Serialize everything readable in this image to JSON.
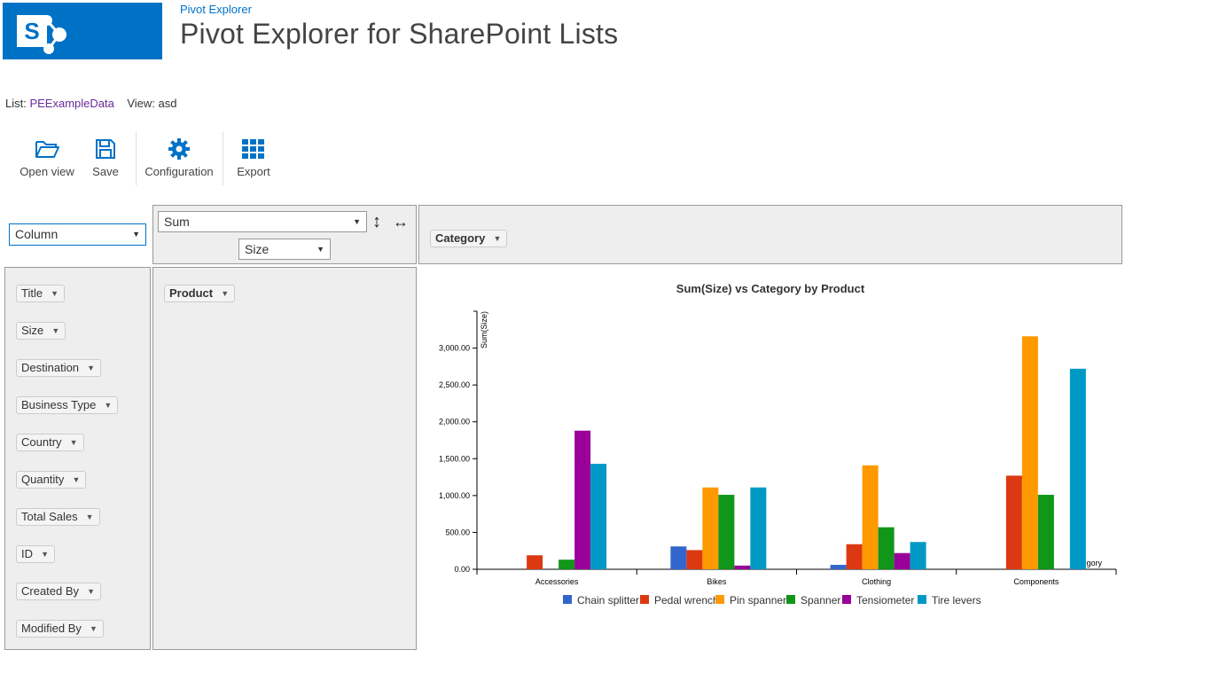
{
  "header": {
    "breadcrumb": "Pivot Explorer",
    "title": "Pivot Explorer for SharePoint Lists",
    "logo_letter": "S",
    "brand_color": "#0072c6"
  },
  "list_info": {
    "list_label": "List:",
    "list_name": "PEExampleData",
    "view_label": "View:",
    "view_name": "asd"
  },
  "toolbar": {
    "open_view": "Open view",
    "save": "Save",
    "configuration": "Configuration",
    "export": "Export",
    "icons": [
      "folder-open-icon",
      "save-icon",
      "gear-icon",
      "grid-icon"
    ]
  },
  "controls": {
    "chart_type": "Column",
    "aggregate": "Sum",
    "value_field": "Size",
    "vertical_arrow": "↕",
    "horizontal_arrow": "↔"
  },
  "columns_panel": {
    "fields": [
      "Category"
    ]
  },
  "rows_panel": {
    "fields": [
      "Product"
    ]
  },
  "fields_panel": {
    "fields": [
      "Title",
      "Size",
      "Destination",
      "Business Type",
      "Country",
      "Quantity",
      "Total Sales",
      "ID",
      "Created By",
      "Modified By"
    ]
  },
  "chart_data": {
    "type": "bar",
    "title": "Sum(Size) vs Category by Product",
    "ylabel": "Sum(Size)",
    "xlabel": "Category",
    "categories": [
      "Accessories",
      "Bikes",
      "Clothing",
      "Components"
    ],
    "ylim": [
      0,
      3500
    ],
    "yticks": [
      0,
      500,
      1000,
      1500,
      2000,
      2500,
      3000
    ],
    "ytick_labels": [
      "0.00",
      "500.00",
      "1,000.00",
      "1,500.00",
      "2,000.00",
      "2,500.00",
      "3,000.00"
    ],
    "legend_position": "bottom",
    "series": [
      {
        "name": "Chain splitter",
        "color": "#3366cc",
        "values": [
          0,
          310,
          60,
          0
        ]
      },
      {
        "name": "Pedal wrench",
        "color": "#dc3912",
        "values": [
          190,
          260,
          340,
          1270
        ]
      },
      {
        "name": "Pin spanner",
        "color": "#ff9900",
        "values": [
          0,
          1110,
          1410,
          3160
        ]
      },
      {
        "name": "Spanner",
        "color": "#109618",
        "values": [
          130,
          1010,
          570,
          1010
        ]
      },
      {
        "name": "Tensiometer",
        "color": "#990099",
        "values": [
          1880,
          50,
          220,
          0
        ]
      },
      {
        "name": "Tire levers",
        "color": "#0099c6",
        "values": [
          1430,
          1110,
          370,
          2720
        ]
      }
    ]
  }
}
